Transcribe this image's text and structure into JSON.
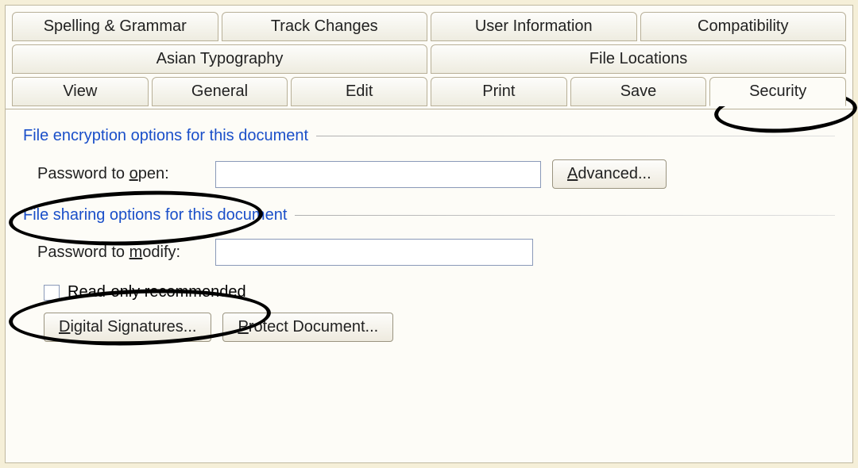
{
  "tabs": {
    "row1": [
      "Spelling & Grammar",
      "Track Changes",
      "User Information",
      "Compatibility"
    ],
    "row2": [
      "Asian Typography",
      "File Locations"
    ],
    "row3": [
      "View",
      "General",
      "Edit",
      "Print",
      "Save",
      "Security"
    ],
    "active": "Security"
  },
  "groups": {
    "encryption": {
      "header": "File encryption options for this document",
      "password_open_label_pre": "Password to ",
      "password_open_ul": "o",
      "password_open_label_post": "pen:",
      "advanced_ul": "A",
      "advanced_rest": "dvanced..."
    },
    "sharing": {
      "header": "File sharing options for this document",
      "password_modify_label_pre": "Password to ",
      "password_modify_ul": "m",
      "password_modify_label_post": "odify:",
      "readonly_label": "Read-only recommended",
      "digsig_ul": "D",
      "digsig_rest": "igital Signatures...",
      "protect_ul": "P",
      "protect_rest": "rotect Document..."
    }
  },
  "values": {
    "password_open": "",
    "password_modify": "",
    "readonly_checked": false
  }
}
